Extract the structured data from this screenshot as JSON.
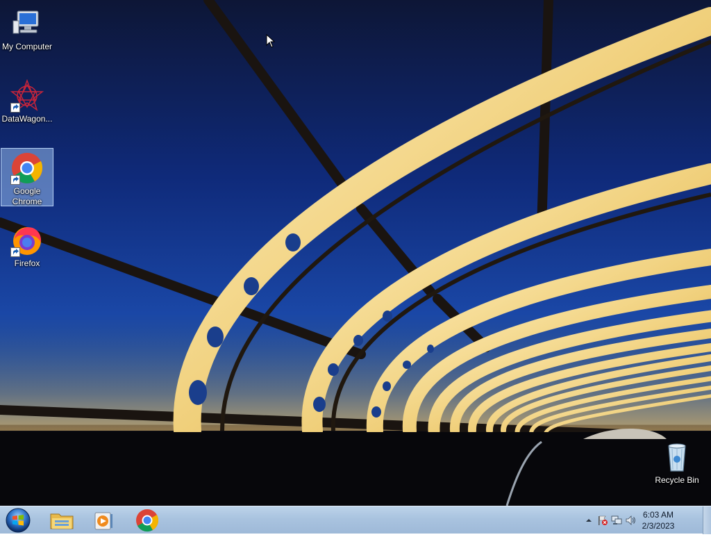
{
  "desktop": {
    "icons": [
      {
        "label": "My Computer",
        "icon": "computer-icon"
      },
      {
        "label": "DataWagon...",
        "icon": "datawagon-icon"
      },
      {
        "label": "Google Chrome",
        "icon": "chrome-icon",
        "selected": true
      },
      {
        "label": "Firefox",
        "icon": "firefox-icon"
      },
      {
        "label": "Recycle Bin",
        "icon": "recycle-bin-icon"
      }
    ]
  },
  "taskbar": {
    "start_icon": "windows-orb-icon",
    "pinned": [
      {
        "name": "Windows Explorer",
        "icon": "folder-icon"
      },
      {
        "name": "Windows Media Player",
        "icon": "media-player-icon"
      },
      {
        "name": "Google Chrome",
        "icon": "chrome-icon"
      }
    ],
    "tray": {
      "icons": [
        "show-hidden-icons-chevron",
        "action-center-flag-icon",
        "network-icon",
        "volume-icon"
      ],
      "time": "6:03 AM",
      "date": "2/3/2023"
    }
  },
  "colors": {
    "sky_top": "#0d1636",
    "sky_mid": "#1a47a6",
    "bridge_gold": "#f2d48a",
    "taskbar": "#a9c3df"
  }
}
